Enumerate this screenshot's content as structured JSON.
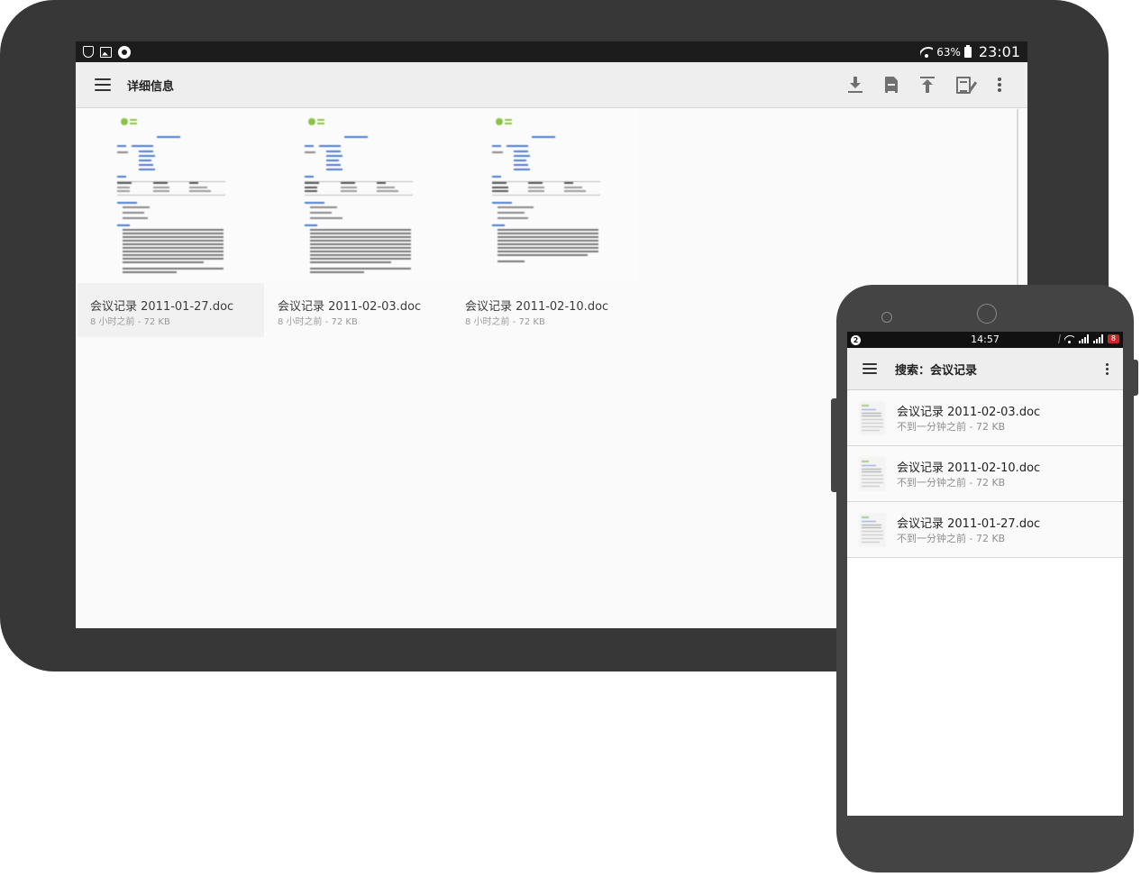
{
  "tablet": {
    "status": {
      "battery": "63%",
      "time": "23:01"
    },
    "toolbar": {
      "title": "详细信息"
    },
    "files": [
      {
        "name": "会议记录 2011-01-27.doc",
        "meta": "8 小时之前 - 72 KB",
        "selected": true
      },
      {
        "name": "会议记录 2011-02-03.doc",
        "meta": "8 小时之前 - 72 KB",
        "selected": false
      },
      {
        "name": "会议记录 2011-02-10.doc",
        "meta": "8 小时之前 - 72 KB",
        "selected": false
      }
    ]
  },
  "phone": {
    "status": {
      "notification_count": "2",
      "time": "14:57",
      "battery": "8"
    },
    "toolbar": {
      "title": "搜索：会议记录"
    },
    "results": [
      {
        "name": "会议记录 2011-02-03.doc",
        "meta": "不到一分钟之前 - 72 KB"
      },
      {
        "name": "会议记录 2011-02-10.doc",
        "meta": "不到一分钟之前 - 72 KB"
      },
      {
        "name": "会议记录 2011-01-27.doc",
        "meta": "不到一分钟之前 - 72 KB"
      }
    ]
  },
  "colors": {
    "device_body": "#373737",
    "toolbar_bg": "#eeeeee",
    "status_bar": "#1c1c1c",
    "battery_low": "#c62828",
    "link_blue": "#4a7bd0",
    "logo_green": "#8bc34a"
  }
}
